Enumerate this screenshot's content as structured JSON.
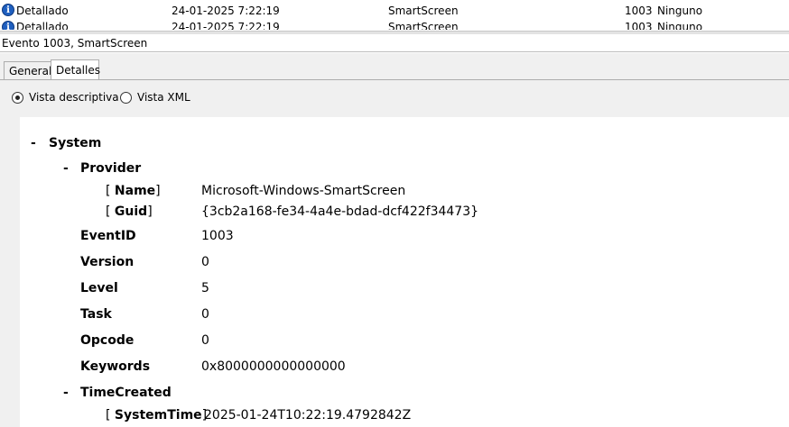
{
  "event_list": {
    "rows": [
      {
        "level": "Detallado",
        "date": "24-01-2025 7:22:19",
        "source": "SmartScreen",
        "id": "1003",
        "category": "Ninguno"
      },
      {
        "level": "Detallado",
        "date": "24-01-2025 7:22:19",
        "source": "SmartScreen",
        "id": "1003",
        "category": "Ninguno"
      }
    ]
  },
  "pane": {
    "title": "Evento 1003, SmartScreen",
    "tabs": [
      {
        "label": "General"
      },
      {
        "label": "Detalles"
      }
    ],
    "views": {
      "descriptive": "Vista descriptiva",
      "xml": "Vista XML",
      "selected": "descriptive"
    }
  },
  "details": {
    "toggle": "-",
    "system": "System",
    "provider": "Provider",
    "provider_name_key": "Name",
    "provider_name_value": "Microsoft-Windows-SmartScreen",
    "provider_guid_key": "Guid",
    "provider_guid_value": "{3cb2a168-fe34-4a4e-bdad-dcf422f34473}",
    "fields": [
      {
        "key": "EventID",
        "value": "1003"
      },
      {
        "key": "Version",
        "value": "0"
      },
      {
        "key": "Level",
        "value": "5"
      },
      {
        "key": "Task",
        "value": "0"
      },
      {
        "key": "Opcode",
        "value": "0"
      },
      {
        "key": "Keywords",
        "value": "0x8000000000000000"
      }
    ],
    "time_created": "TimeCreated",
    "system_time_key": "SystemTime",
    "system_time_value": "2025-01-24T10:22:19.4792842Z"
  },
  "colors": {
    "info_icon": "#1f5fbf",
    "panel_bg": "#f0f0f0"
  },
  "icons": {
    "info": "information-icon"
  }
}
